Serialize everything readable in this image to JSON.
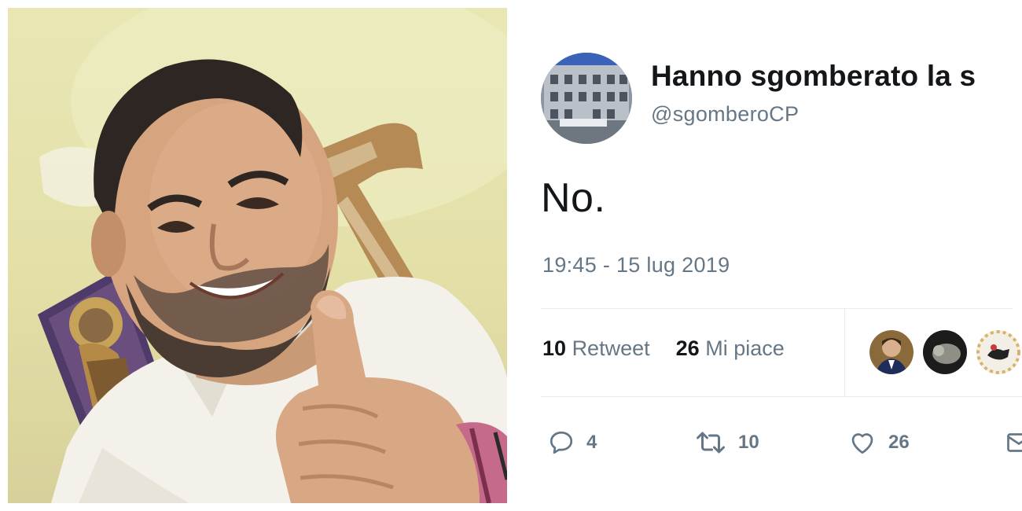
{
  "photo": {
    "description_icon": "selfie-photo"
  },
  "tweet": {
    "display_name": "Hanno sgomberato la s",
    "handle": "@sgomberoCP",
    "text": "No.",
    "timestamp": "19:45 - 15 lug 2019",
    "stats": {
      "retweets_count": "10",
      "retweets_label": "Retweet",
      "likes_count": "26",
      "likes_label": "Mi piace"
    },
    "actions": {
      "reply_count": "4",
      "retweet_count": "10",
      "like_count": "26"
    },
    "colors": {
      "text": "#14171a",
      "secondary": "#657786",
      "divider": "#e6ecf0"
    }
  }
}
